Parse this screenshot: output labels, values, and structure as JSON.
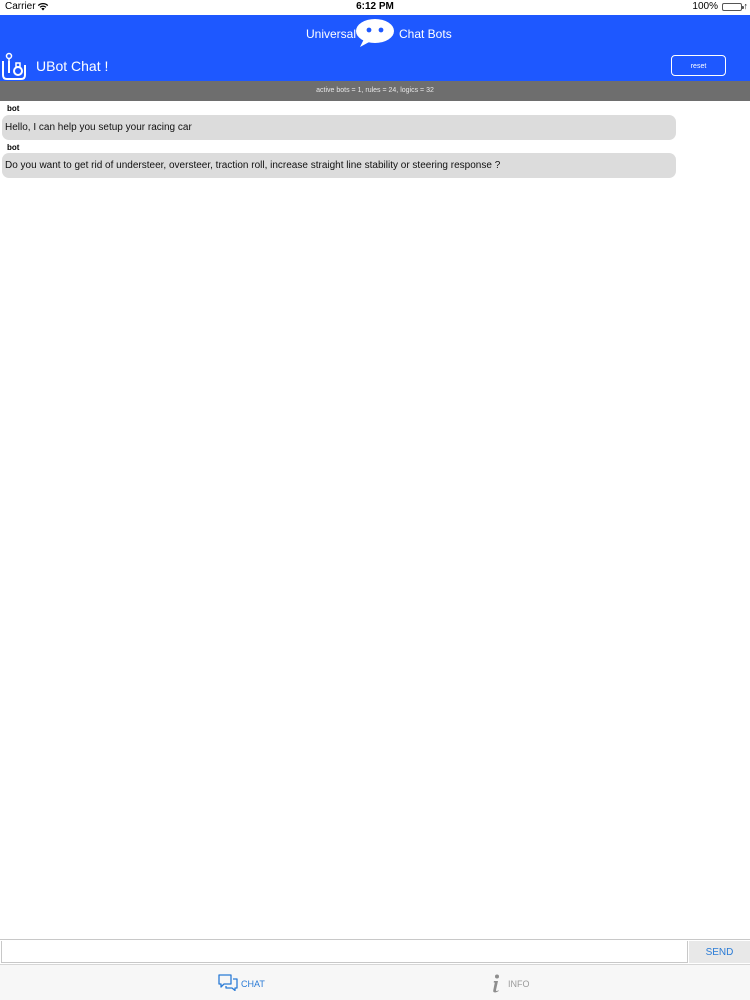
{
  "status_bar": {
    "carrier": "Carrier",
    "time": "6:12 PM",
    "battery": "100%"
  },
  "header": {
    "banner_left": "Universal",
    "banner_right": "Chat Bots",
    "app_title": "UBot Chat !",
    "reset_label": "reset",
    "stats": "active bots = 1, rules = 24, logics = 32",
    "accent_color": "#1e58ff"
  },
  "messages": [
    {
      "sender": "bot",
      "text": "Hello, I can help you setup your racing car"
    },
    {
      "sender": "bot",
      "text": "Do you want to get rid of understeer, oversteer, traction roll, increase straight line stability or steering response ?"
    }
  ],
  "input": {
    "value": "",
    "placeholder": "",
    "send_label": "SEND"
  },
  "tabs": [
    {
      "label": "CHAT",
      "icon": "chat-bubbles-icon",
      "selected": true
    },
    {
      "label": "INFO",
      "icon": "info-icon",
      "selected": false
    }
  ]
}
